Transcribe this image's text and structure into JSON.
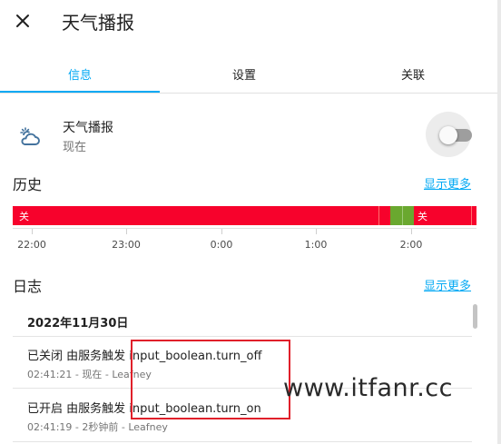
{
  "header": {
    "title": "天气播报"
  },
  "tabs": [
    {
      "label": "信息"
    },
    {
      "label": "设置"
    },
    {
      "label": "关联"
    }
  ],
  "entity": {
    "name": "天气播报",
    "state": "现在",
    "icon": "weather-partly-cloudy-icon",
    "toggle_on": false
  },
  "history": {
    "title": "历史",
    "more": "显示更多",
    "segments": [
      {
        "state": "关",
        "color": "#f7022c"
      },
      {
        "state": "开",
        "color": "#6aa82f"
      },
      {
        "state": "关",
        "color": "#f7022c"
      }
    ],
    "axis_ticks": [
      "22:00",
      "23:00",
      "0:00",
      "1:00",
      "2:00"
    ]
  },
  "logbook": {
    "title": "日志",
    "more": "显示更多",
    "date": "2022年11月30日",
    "entries": [
      {
        "message": "已关闭 由服务触发 input_boolean.turn_off",
        "detail": "02:41:21 - 现在 - Leafney"
      },
      {
        "message": "已开启 由服务触发 input_boolean.turn_on",
        "detail": "02:41:19 - 2秒钟前 - Leafney"
      }
    ]
  },
  "watermark": "www.itfanr.cc",
  "colors": {
    "accent": "#03a9f4",
    "off": "#f7022c",
    "on": "#6aa82f",
    "highlight": "#e0202a"
  }
}
